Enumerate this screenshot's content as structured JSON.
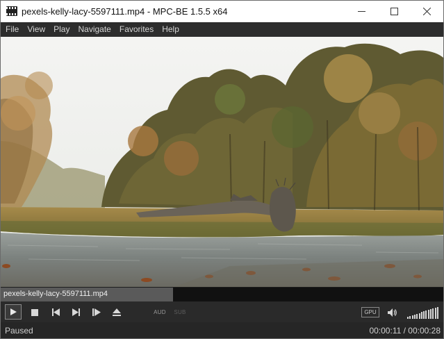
{
  "window": {
    "title": "pexels-kelly-lacy-5597111.mp4 - MPC-BE 1.5.5 x64"
  },
  "menu": [
    "File",
    "View",
    "Play",
    "Navigate",
    "Favorites",
    "Help"
  ],
  "seek": {
    "filename": "pexels-kelly-lacy-5597111.mp4",
    "progress": 0.39
  },
  "controls": {
    "audio_label": "AUD",
    "subtitle_label": "SUB",
    "gpu_label": "GPU",
    "volume_level": 1.0
  },
  "status": {
    "state": "Paused",
    "time": "00:00:11 / 00:00:28"
  }
}
